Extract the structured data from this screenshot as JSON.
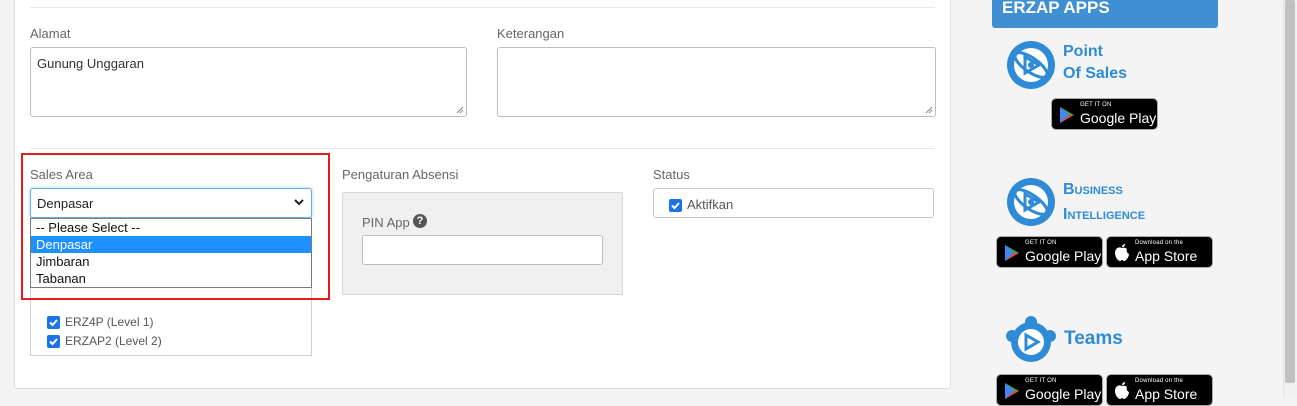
{
  "form": {
    "alamat_label": "Alamat",
    "alamat_value": "Gunung Unggaran",
    "keterangan_label": "Keterangan",
    "keterangan_value": "",
    "sales_area_label": "Sales Area",
    "sales_area_selected": "Denpasar",
    "sales_area_options": [
      "-- Please Select --",
      "Denpasar",
      "Jimbaran",
      "Tabanan"
    ],
    "checkbox_items": [
      {
        "label": "ERZ4P (Level 1)",
        "checked": true
      },
      {
        "label": "ERZAP2 (Level 2)",
        "checked": true
      }
    ],
    "pengaturan_label": "Pengaturan Absensi",
    "pin_label": "PIN App",
    "pin_value": "",
    "status_label": "Status",
    "status_option": "Aktifkan",
    "status_checked": true
  },
  "sidebar": {
    "header": "ERZAP APPS",
    "apps": [
      {
        "title_line1": "Point",
        "title_line2": "Of Sales",
        "icon": "pos-logo-icon"
      },
      {
        "title_line1": "Business",
        "title_line2": "Intelligence",
        "icon": "bi-logo-icon"
      },
      {
        "title_line1": "Teams",
        "title_line2": "",
        "icon": "teams-logo-icon"
      }
    ],
    "google_play_small": "GET IT ON",
    "google_play_big": "Google Play",
    "app_store_small": "Download on the",
    "app_store_big": "App Store"
  },
  "colors": {
    "accent": "#3f8fd2",
    "highlight_box": "#e31b1b",
    "selected_option": "#1e90ff",
    "checkbox": "#1a73e8"
  }
}
